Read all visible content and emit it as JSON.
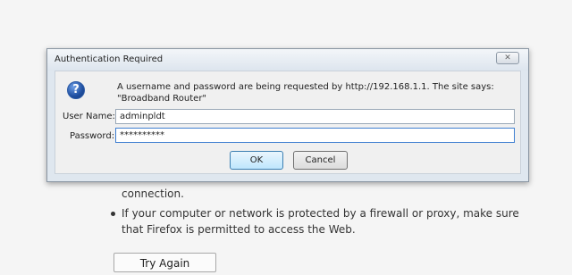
{
  "dialog": {
    "title": "Authentication Required",
    "message": "A username and password are being requested by http://192.168.1.1. The site says: \"Broadband Router\"",
    "username_label": "User Name:",
    "username_value": "adminpldt",
    "password_label": "Password:",
    "password_value": "**********",
    "ok_label": "OK",
    "cancel_label": "Cancel",
    "icon": "question-icon"
  },
  "background": {
    "line1": "connection.",
    "line2": "If your computer or network is protected by a firewall or proxy, make sure",
    "line3": "that Firefox is permitted to access the Web.",
    "button": "Try Again"
  }
}
